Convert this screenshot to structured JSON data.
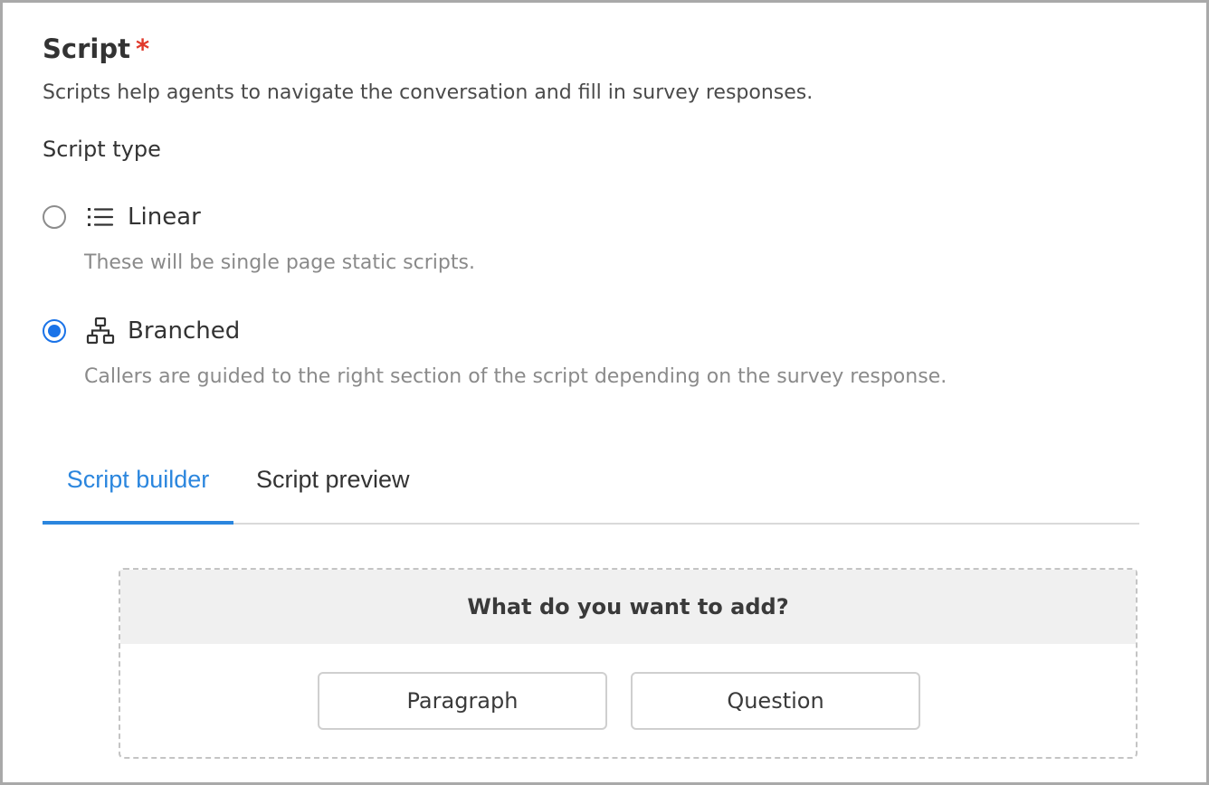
{
  "form": {
    "title": "Script",
    "required_marker": "*",
    "description": "Scripts help agents to navigate the conversation and fill in survey responses.",
    "script_type_label": "Script type",
    "options": [
      {
        "label": "Linear",
        "description": "These will be single page static scripts.",
        "icon": "list-icon",
        "selected": false
      },
      {
        "label": "Branched",
        "description": "Callers are guided to the right section of the script depending on the survey response.",
        "icon": "sitemap-icon",
        "selected": true
      }
    ]
  },
  "tabs": [
    {
      "label": "Script builder",
      "active": true
    },
    {
      "label": "Script preview",
      "active": false
    }
  ],
  "builder": {
    "prompt": "What do you want to add?",
    "buttons": {
      "paragraph": "Paragraph",
      "question": "Question"
    }
  },
  "colors": {
    "accent": "#2b86de",
    "radio_selected": "#1a73e8",
    "required": "#e0392b",
    "muted_text": "#8a8a8a"
  }
}
